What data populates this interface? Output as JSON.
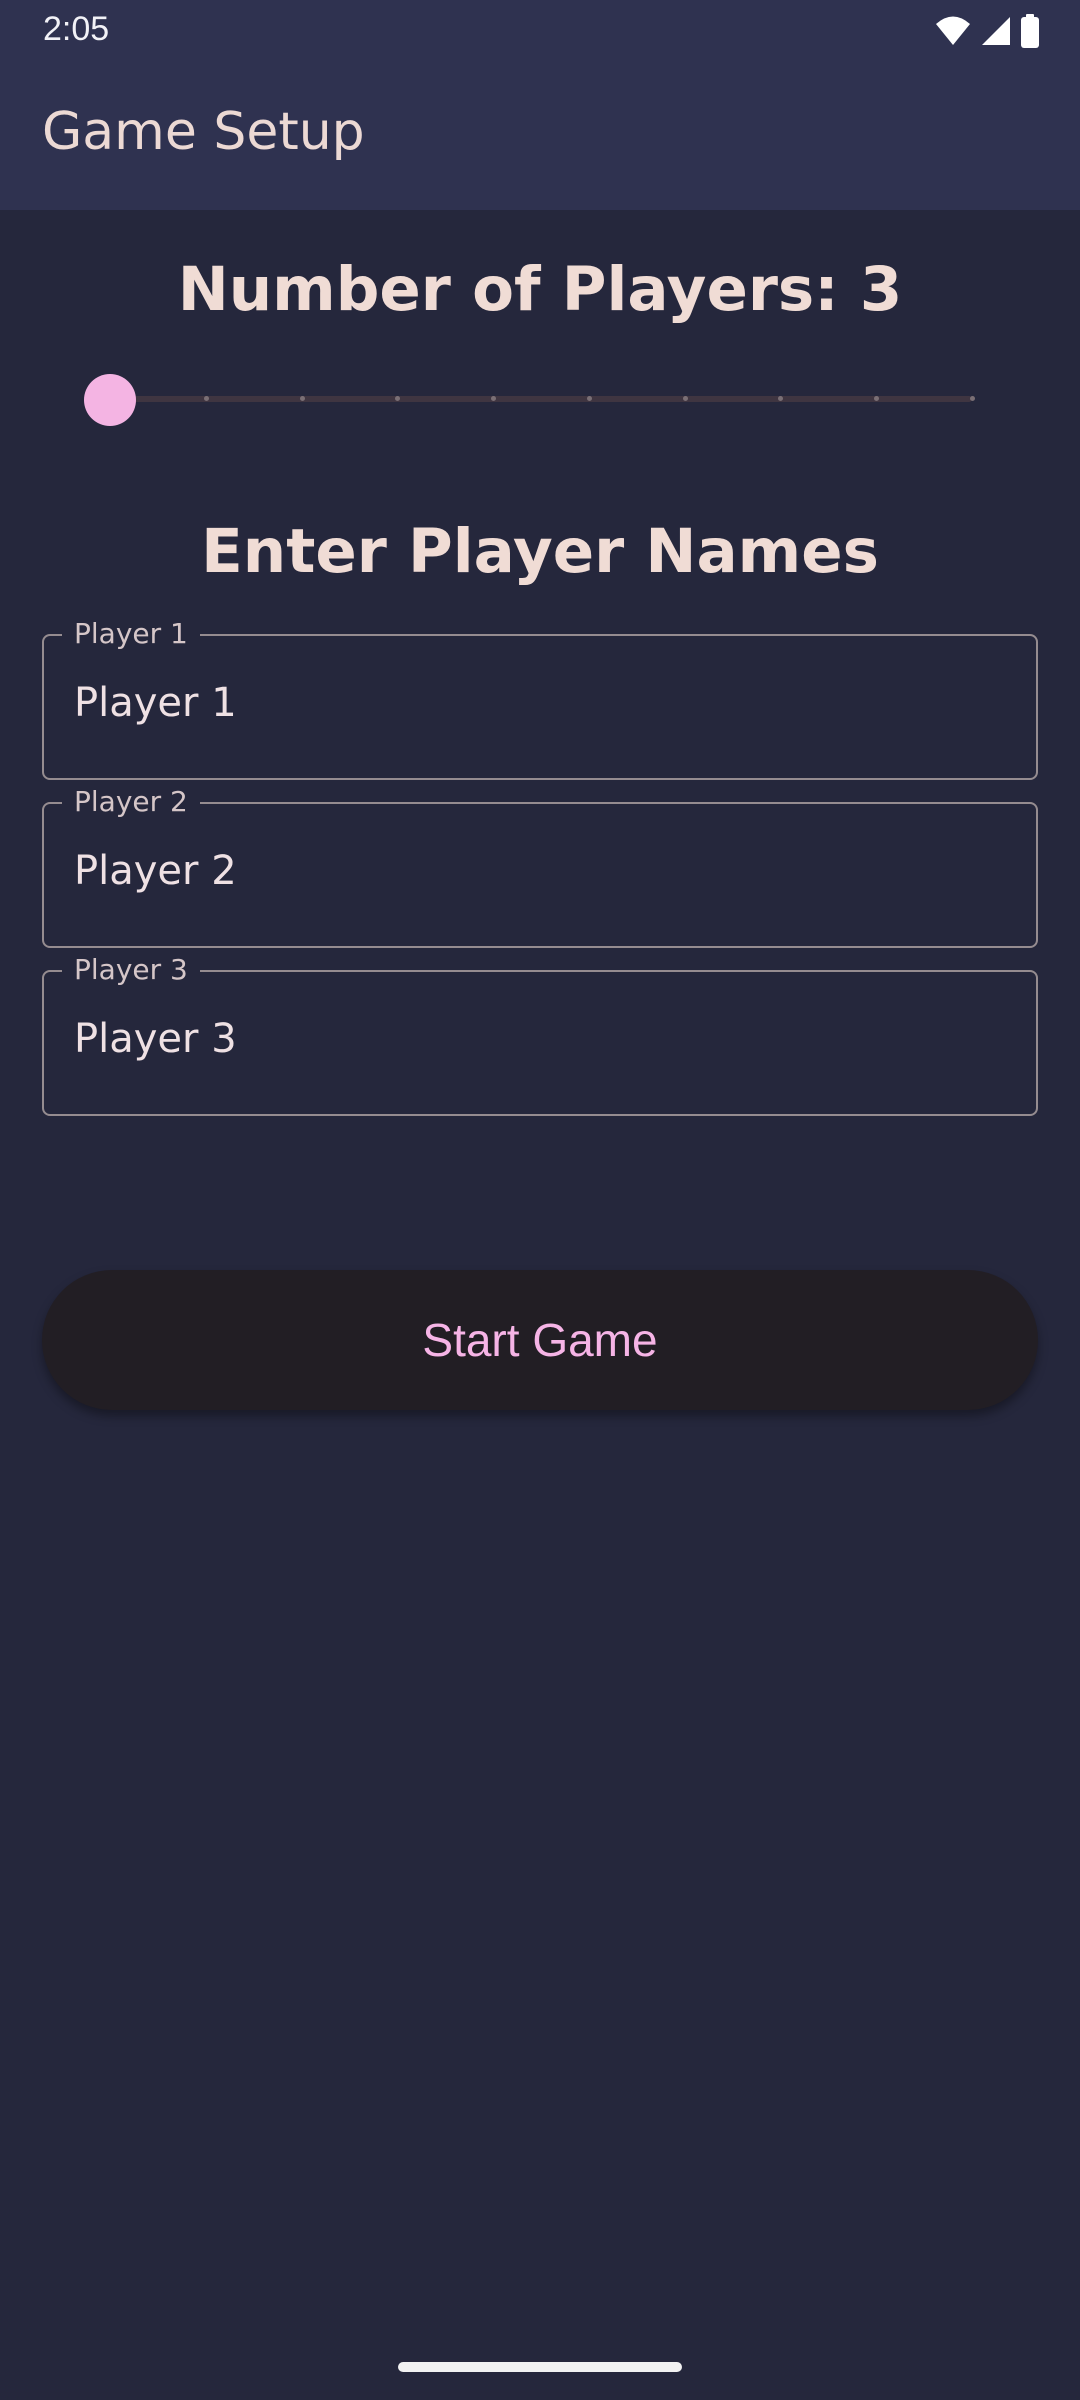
{
  "status_bar": {
    "time": "2:05",
    "icons": [
      "wifi-icon",
      "cell-signal-icon",
      "battery-icon"
    ]
  },
  "app_bar": {
    "title": "Game Setup"
  },
  "player_count": {
    "heading": "Number of Players: 3",
    "slider": {
      "value": 3,
      "steps": 10,
      "fraction": 0.0
    }
  },
  "names_section": {
    "heading": "Enter Player Names",
    "fields": [
      {
        "label": "Player 1",
        "value": "Player 1"
      },
      {
        "label": "Player 2",
        "value": "Player 2"
      },
      {
        "label": "Player 3",
        "value": "Player 3"
      }
    ]
  },
  "start_button": {
    "label": "Start Game"
  },
  "colors": {
    "background": "#25273c",
    "app_bar": "#2f3250",
    "accent": "#f4b4e3",
    "heading_text": "#f0dcd5"
  }
}
